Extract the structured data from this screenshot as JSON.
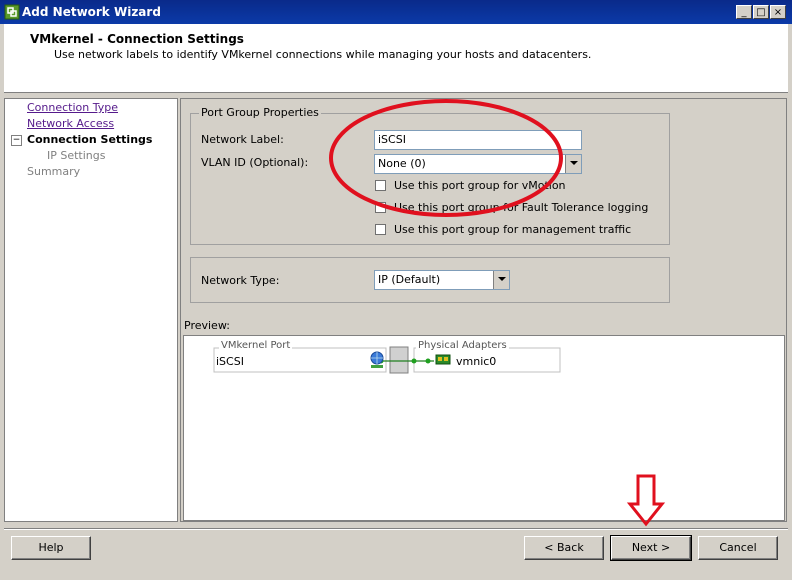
{
  "window": {
    "title": "Add Network Wizard",
    "minimize_label": "_",
    "maximize_label": "□",
    "close_label": "×"
  },
  "header": {
    "title": "VMkernel - Connection Settings",
    "subtitle": "Use network labels to identify VMkernel connections while managing your hosts and datacenters."
  },
  "nav": {
    "items": [
      {
        "label": "Connection Type"
      },
      {
        "label": "Network Access"
      },
      {
        "label": "Connection Settings",
        "expander": "−"
      },
      {
        "label": "IP Settings"
      },
      {
        "label": "Summary"
      }
    ]
  },
  "port_group": {
    "legend": "Port Group Properties",
    "network_label_caption": "Network Label:",
    "network_label_value": "iSCSI",
    "vlan_caption": "VLAN ID (Optional):",
    "vlan_value": "None (0)",
    "checkboxes": [
      {
        "label": "Use this port group for vMotion",
        "checked": false
      },
      {
        "label": "Use this port group for Fault Tolerance logging",
        "checked": false
      },
      {
        "label": "Use this port group for management traffic",
        "checked": false
      }
    ]
  },
  "network_type": {
    "caption": "Network Type:",
    "value": "IP (Default)"
  },
  "preview": {
    "caption": "Preview:",
    "vmkernel_port_label": "VMkernel Port",
    "port_name": "iSCSI",
    "physical_adapters_label": "Physical Adapters",
    "adapter_name": "vmnic0"
  },
  "buttons": {
    "help": "Help",
    "back": "< Back",
    "next": "Next >",
    "cancel": "Cancel"
  },
  "colors": {
    "titlebar": "#0a2a8a",
    "annotation": "#e0101e",
    "link": "#551a8b"
  }
}
